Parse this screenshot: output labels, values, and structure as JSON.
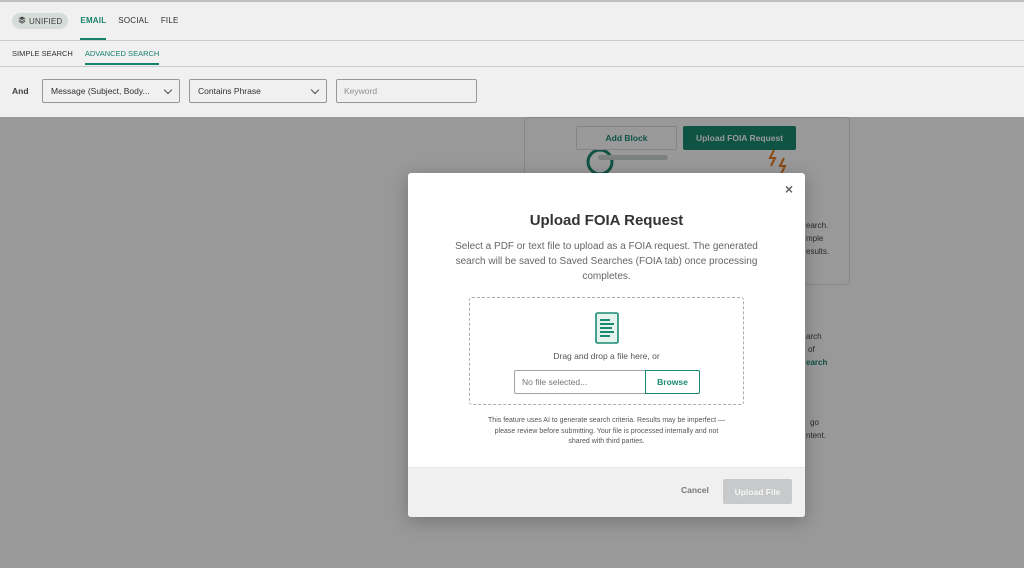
{
  "nav": {
    "unified_label": "UNIFIED",
    "tabs": [
      {
        "label": "EMAIL"
      },
      {
        "label": "SOCIAL"
      },
      {
        "label": "FILE"
      }
    ]
  },
  "subnav": {
    "tabs": [
      {
        "label": "SIMPLE SEARCH"
      },
      {
        "label": "ADVANCED SEARCH"
      }
    ]
  },
  "filter": {
    "operator": "And",
    "field_select": "Message (Subject, Body...",
    "condition_select": "Contains Phrase",
    "keyword_placeholder": "Keyword"
  },
  "background": {
    "add_block": "Add Block",
    "upload_foia": "Upload FOIA Request",
    "fragments": [
      "earch.",
      "mple",
      "esults.",
      "arch",
      "of",
      "earch",
      "go",
      "ntent."
    ]
  },
  "modal": {
    "title": "Upload FOIA Request",
    "description": "Select a PDF or text file to upload as a FOIA request. The generated search will be saved to Saved Searches (FOIA tab) once processing completes.",
    "drag_text": "Drag and drop a file here, or",
    "file_placeholder": "No file selected...",
    "browse_label": "Browse",
    "disclaimer": "This feature uses AI to generate search criteria. Results may be imperfect — please review before submitting. Your file is processed internally and not shared with third parties.",
    "cancel_label": "Cancel",
    "upload_label": "Upload File",
    "close_glyph": "×"
  },
  "colors": {
    "accent": "#1a8a72",
    "disabled": "#c7c9ca"
  }
}
